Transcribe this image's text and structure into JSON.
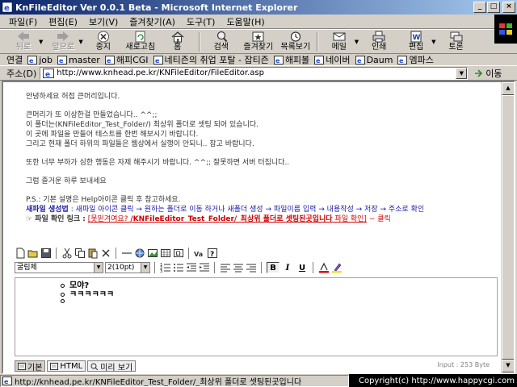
{
  "window": {
    "title": "KnFileEditor Ver 0.0.1 Beta - Microsoft Internet Explorer",
    "controls": [
      "_",
      "□",
      "×"
    ]
  },
  "menu": [
    "파일(F)",
    "편집(E)",
    "보기(V)",
    "즐겨찾기(A)",
    "도구(T)",
    "도움말(H)"
  ],
  "toolbar": {
    "back": "뒤로",
    "forward": "앞으로",
    "stop": "중지",
    "refresh": "새로고침",
    "home": "홈",
    "search": "검색",
    "favorites": "즐겨찾기",
    "history": "목록보기",
    "mail": "메일",
    "print": "인쇄",
    "edit": "편집",
    "discuss": "토론"
  },
  "links": {
    "title": "연결",
    "items": [
      "job",
      "master",
      "해피CGI",
      "네티즌의 취업 포탈 - 잡티즌",
      "해피볼",
      "네이버",
      "Daum",
      "엠파스"
    ]
  },
  "address": {
    "label": "주소(D)",
    "url": "http://www.knhead.pe.kr/KNFileEditor/FileEditor.asp",
    "go": "이동"
  },
  "page": {
    "greeting": "안녕하세요 허접 큰머리입니다.",
    "line1": "큰머리가 또 이상한걸 만들었습니다.. ^^;;",
    "line2": "이 폴더는(KNFileEditor_Test_Folder/) 최상위 폴더로 셋팅 되어 있습니다.",
    "line3": "이 곳에 파일을 만들어 테스트를 한번 해보시기 바랍니다.",
    "line4": "그리고 현재 폴더 하위의 파일들은 웹상에서 실행이 안되니.. 참고 바랍니다.",
    "line5": "또한 너무 부하가 심한 행동은 자제 해주시기 바랍니다. ^^;; 잘못하면 서버 터집니다..",
    "line6": "그럼 즐거운 하루 보내세요",
    "ps": "P.S.: 기본 설명은 Help아이콘 클릭 후 참고하세요.",
    "new_file_label": "새파일 생성법",
    "new_file_text": " : 새파일 아이콘 클릭 → 원하는 폴더로 이동 하거나 새폴더 생성 → 파일이름 입력 → 내용작성 → 저장 → 주소로 확인",
    "file_link_label": "☞ 파일 확인 링크 :",
    "file_link_open": "[못믿겨여요? ",
    "file_link_path": "/KNFileEditor_Test_Folder/_최상위 폴더로 셋팅된곳입니다",
    "file_link_check": " 파일 확인]",
    "file_link_click": "~ 클릭"
  },
  "editor": {
    "font": "굴림체",
    "size": "2(10pt)",
    "bold_label": "B",
    "italic_label": "I",
    "underline_label": "U",
    "content": [
      "모야?",
      "ㅋㅋㅋㅋㅋㅋ",
      ""
    ],
    "modes": [
      "기본",
      "HTML",
      "미리 보기"
    ],
    "input_count": "Input : 253 Byte"
  },
  "status": {
    "url": "http://knhead.pe.kr/KNFileEditor_Test_Folder/_최상위 폴더로 셋팅된곳입니다",
    "copyright": "Copyright(c) http://www.happycgi.com"
  },
  "colors": {
    "title_start": "#0a246a",
    "title_end": "#a6caf0",
    "chrome": "#d4d0c8",
    "link_red": "#d00000",
    "label_blue": "#1a1aa6"
  }
}
